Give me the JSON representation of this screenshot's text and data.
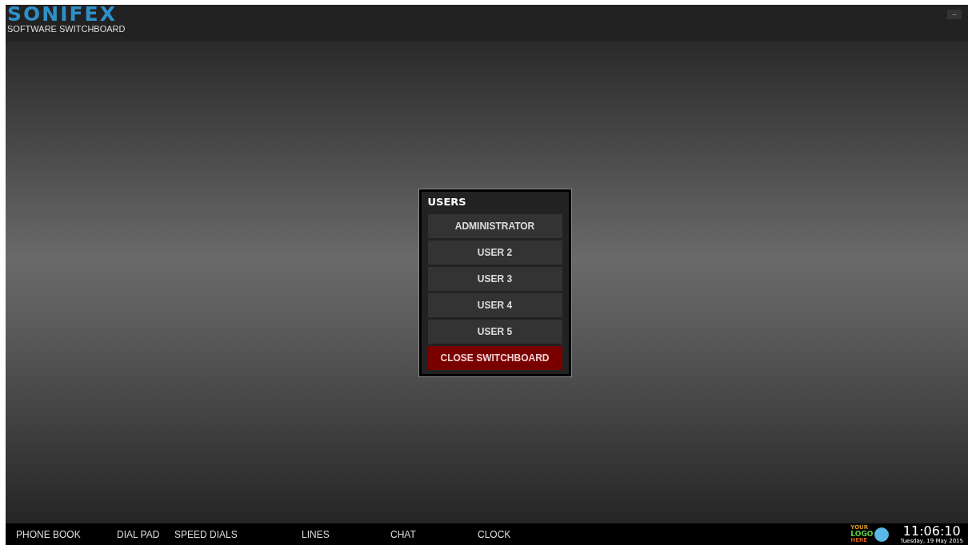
{
  "header": {
    "brand": "SONIFEX",
    "subtitle": "SOFTWARE SWITCHBOARD",
    "minimize": "–"
  },
  "dialog": {
    "title": "USERS",
    "items": [
      {
        "label": "ADMINISTRATOR",
        "kind": "user"
      },
      {
        "label": "USER 2",
        "kind": "user"
      },
      {
        "label": "USER 3",
        "kind": "user"
      },
      {
        "label": "USER 4",
        "kind": "user"
      },
      {
        "label": "USER 5",
        "kind": "user"
      },
      {
        "label": "CLOSE SWITCHBOARD",
        "kind": "close"
      }
    ]
  },
  "nav": [
    "PHONE BOOK",
    "DIAL PAD",
    "SPEED DIALS",
    "LINES",
    "CHAT",
    "CLOCK"
  ],
  "logo": [
    "YOUR",
    "LOGO",
    "HERE"
  ],
  "clock": {
    "time": "11:06:10",
    "date": "Tuesday, 19 May 2015"
  }
}
